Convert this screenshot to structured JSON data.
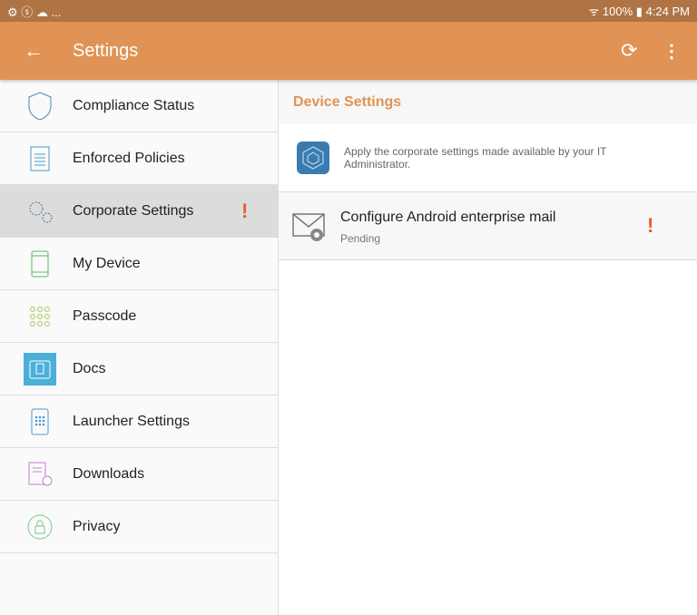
{
  "status_bar": {
    "left_icons": "⚙ ⓢ ☁ ...",
    "battery": "100%",
    "time": "4:24 PM"
  },
  "app_bar": {
    "title": "Settings"
  },
  "sidebar": {
    "items": [
      {
        "label": "Compliance Status",
        "icon": "shield-icon"
      },
      {
        "label": "Enforced Policies",
        "icon": "document-icon"
      },
      {
        "label": "Corporate Settings",
        "icon": "gears-icon",
        "selected": true,
        "alert": "!"
      },
      {
        "label": "My Device",
        "icon": "phone-icon"
      },
      {
        "label": "Passcode",
        "icon": "keypad-icon"
      },
      {
        "label": "Docs",
        "icon": "docs-icon"
      },
      {
        "label": "Launcher Settings",
        "icon": "launcher-icon"
      },
      {
        "label": "Downloads",
        "icon": "downloads-icon"
      },
      {
        "label": "Privacy",
        "icon": "lock-icon"
      }
    ]
  },
  "main": {
    "section_title": "Device Settings",
    "intro": "Apply the corporate settings made available by your IT Administrator.",
    "items": [
      {
        "title": "Configure Android enterprise mail",
        "status": "Pending",
        "alert": "!"
      }
    ]
  },
  "colors": {
    "accent": "#e09355",
    "status_bar": "#b07444",
    "alert": "#e0602a"
  }
}
